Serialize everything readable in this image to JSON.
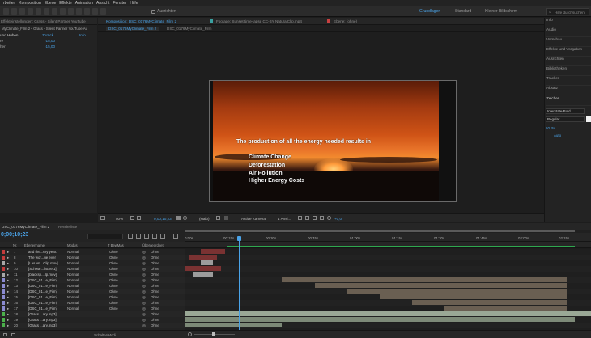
{
  "menu": [
    "rbeiten",
    "Komposition",
    "Ebene",
    "Effekte",
    "Animation",
    "Ansicht",
    "Fenster",
    "Hilfe"
  ],
  "toolbar": {
    "snap_label": "Ausrichten",
    "workspaces": [
      "Grundlagen",
      "Standard",
      "Kleiner Bildschirm"
    ],
    "search_placeholder": "Hilfe durchsuchen"
  },
  "project_panel": {
    "tab": "Effekteinstellungen: Grass - Silent Partner YouTube",
    "path": "MyClimate_Film 2 • Grass - Silent Partner  YouTube Au",
    "section": "und Höhen",
    "reset": "Zurück",
    "info": "Info",
    "rows": [
      {
        "label": "re",
        "value": "-15,00"
      },
      {
        "label": "her",
        "value": "-15,00"
      }
    ]
  },
  "comp_tabs": {
    "composition": "Komposition: DSC_0176MyClimate_Film 2",
    "footage": "Footage: Sunset time-lapse CC-BY NaturalClip.mp4",
    "layer": "Ebene: (ohne)",
    "subtabs": [
      "DSC_0176MyClimate_Film 2",
      "DSC_0176MyClimate_Film"
    ]
  },
  "viewer": {
    "headline": "The production of all the energy needed results in",
    "bullets": [
      "Climate Change",
      "Deforestation",
      "Air Pollution",
      "Higher Energy Costs"
    ]
  },
  "viewer_controls": {
    "zoom": "50%",
    "timecode": "0;00;10;23",
    "resolution": "(Halb)",
    "camera": "Aktive Kamera",
    "views": "1 Ansi...",
    "exposure": "+0,0"
  },
  "right_panel": {
    "items": [
      "Info",
      "Audio",
      "Vorschau",
      "Effekte und Vorgaben",
      "Ausrichten",
      "Bibliotheken",
      "Tracker",
      "Absatz",
      "Zeichen"
    ],
    "font": "Interstate-Bold",
    "style": "Regular",
    "size": "60 Px",
    "tracking": "Auto"
  },
  "timeline": {
    "tab": "DSC_0176MyClimate_Film 2",
    "tab2": "Renderliste",
    "timecode": "0;00;10;23",
    "columns": [
      "Nr.",
      "Ebenenname",
      "Modus",
      "T BewMas",
      "Übergeordnet"
    ],
    "ruler": [
      "0:00s",
      "00:15s",
      "00:30s",
      "00:45s",
      "01:00s",
      "01:15s",
      "01:30s",
      "01:45s",
      "02:00s",
      "02:15s"
    ],
    "footer": "Schalter/Modi",
    "layers": [
      {
        "num": "7",
        "name": "and the...ery year.",
        "mode": "Normal",
        "trkmat": "Ohne",
        "parent": "Ohne",
        "color": "#c23b3b",
        "bar_color": "#7a3232",
        "start": 0.04,
        "end": 0.1
      },
      {
        "num": "8",
        "name": "The wor...ue ever",
        "mode": "Normal",
        "trkmat": "Ohne",
        "parent": "Ohne",
        "color": "#c23b3b",
        "bar_color": "#7a3232",
        "start": 0.01,
        "end": 0.08
      },
      {
        "num": "9",
        "name": "[Las Ve...Clip.mov]",
        "mode": "Normal",
        "trkmat": "Ohne",
        "parent": "Ohne",
        "color": "#a8a8a8",
        "bar_color": "#9c9c9c",
        "start": 0.04,
        "end": 0.07
      },
      {
        "num": "10",
        "name": "[Schwar...läche 1]",
        "mode": "Normal",
        "trkmat": "Ohne",
        "parent": "Ohne",
        "color": "#c23b3b",
        "bar_color": "#7a3232",
        "start": 0.0,
        "end": 0.09
      },
      {
        "num": "11",
        "name": "[blacksp...llp.mov]",
        "mode": "Normal",
        "trkmat": "Ohne",
        "parent": "Ohne",
        "color": "#a8a8a8",
        "bar_color": "#9c9c9c",
        "start": 0.02,
        "end": 0.07
      },
      {
        "num": "12",
        "name": "[DSC_01...e_Film]",
        "mode": "Normal",
        "trkmat": "Ohne",
        "parent": "Ohne",
        "color": "#8a8ad0",
        "bar_color": "#6a5f52",
        "start": 0.24,
        "end": 0.94
      },
      {
        "num": "13",
        "name": "[DSC_01...e_Film]",
        "mode": "Normal",
        "trkmat": "Ohne",
        "parent": "Ohne",
        "color": "#8a8ad0",
        "bar_color": "#6a5f52",
        "start": 0.32,
        "end": 0.94
      },
      {
        "num": "14",
        "name": "[DSC_01...e_Film]",
        "mode": "Normal",
        "trkmat": "Ohne",
        "parent": "Ohne",
        "color": "#8a8ad0",
        "bar_color": "#6a5f52",
        "start": 0.4,
        "end": 0.94
      },
      {
        "num": "15",
        "name": "[DSC_01...e_Film]",
        "mode": "Normal",
        "trkmat": "Ohne",
        "parent": "Ohne",
        "color": "#8a8ad0",
        "bar_color": "#6a5f52",
        "start": 0.48,
        "end": 0.94
      },
      {
        "num": "16",
        "name": "[DSC_01...e_Film]",
        "mode": "Normal",
        "trkmat": "Ohne",
        "parent": "Ohne",
        "color": "#8a8ad0",
        "bar_color": "#6a5f52",
        "start": 0.56,
        "end": 0.94
      },
      {
        "num": "17",
        "name": "[DSC_01...e_Film]",
        "mode": "Normal",
        "trkmat": "Ohne",
        "parent": "Ohne",
        "color": "#8a8ad0",
        "bar_color": "#6a5f52",
        "start": 0.64,
        "end": 0.94
      },
      {
        "num": "18",
        "name": "[Grass ...ary.mp3]",
        "mode": "",
        "trkmat": "",
        "parent": "Ohne",
        "color": "#4bb04b",
        "bar_color": "#9aa896",
        "start": 0.0,
        "end": 1.0
      },
      {
        "num": "19",
        "name": "[Grass ...ary.mp3]",
        "mode": "",
        "trkmat": "",
        "parent": "Ohne",
        "color": "#4bb04b",
        "bar_color": "#7d8a78",
        "start": 0.0,
        "end": 0.96
      },
      {
        "num": "20",
        "name": "[Grass ...ary.mp3]",
        "mode": "",
        "trkmat": "",
        "parent": "Ohne",
        "color": "#4bb04b",
        "bar_color": "#7d8a78",
        "start": 0.0,
        "end": 0.24
      }
    ]
  },
  "colors": {
    "accent": "#4aa3e8",
    "workarea": "#2fa84f"
  }
}
